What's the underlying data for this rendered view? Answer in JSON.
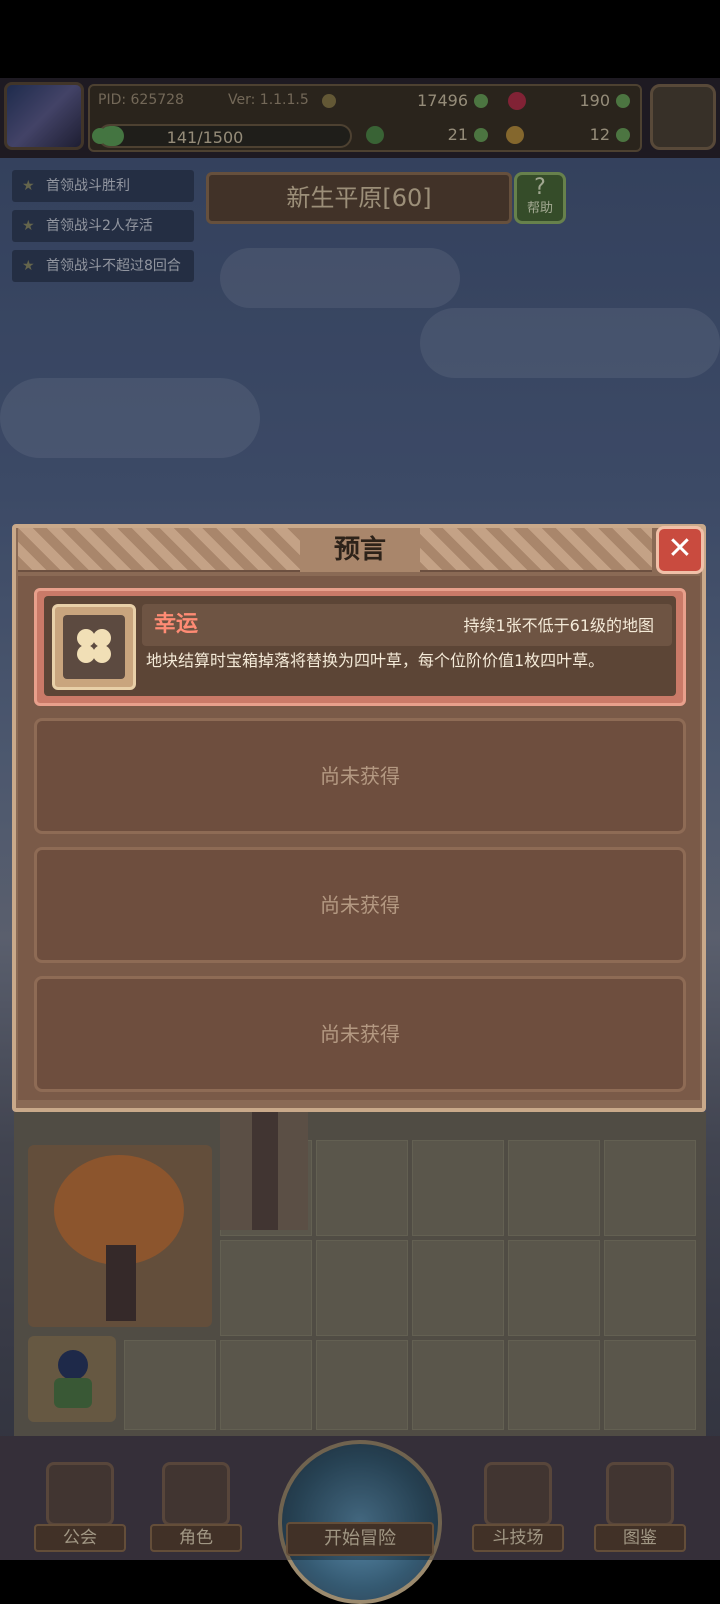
{
  "hud": {
    "pid": "PID: 625728",
    "version": "Ver: 1.1.1.5",
    "gold": "17496",
    "gems": "190",
    "energy_text": "141/1500",
    "energy_fill": 0.094,
    "clover": "21",
    "tickets": "12"
  },
  "quests": [
    "首领战斗胜利",
    "首领战斗2人存活",
    "首领战斗不超过8回合"
  ],
  "region": {
    "name": "新生平原[60]",
    "help_label": "帮助"
  },
  "modal": {
    "title": "预言",
    "close_label": "✕",
    "item": {
      "name": "幸运",
      "requirement": "持续1张不低于61级的地图",
      "description": "地块结算时宝箱掉落将替换为四叶草，每个位阶价值1枚四叶草。"
    },
    "empty_slots": [
      "尚未获得",
      "尚未获得",
      "尚未获得"
    ]
  },
  "nav": {
    "guild": "公会",
    "character": "角色",
    "start": "开始冒险",
    "arena": "斗技场",
    "codex": "图鉴"
  }
}
